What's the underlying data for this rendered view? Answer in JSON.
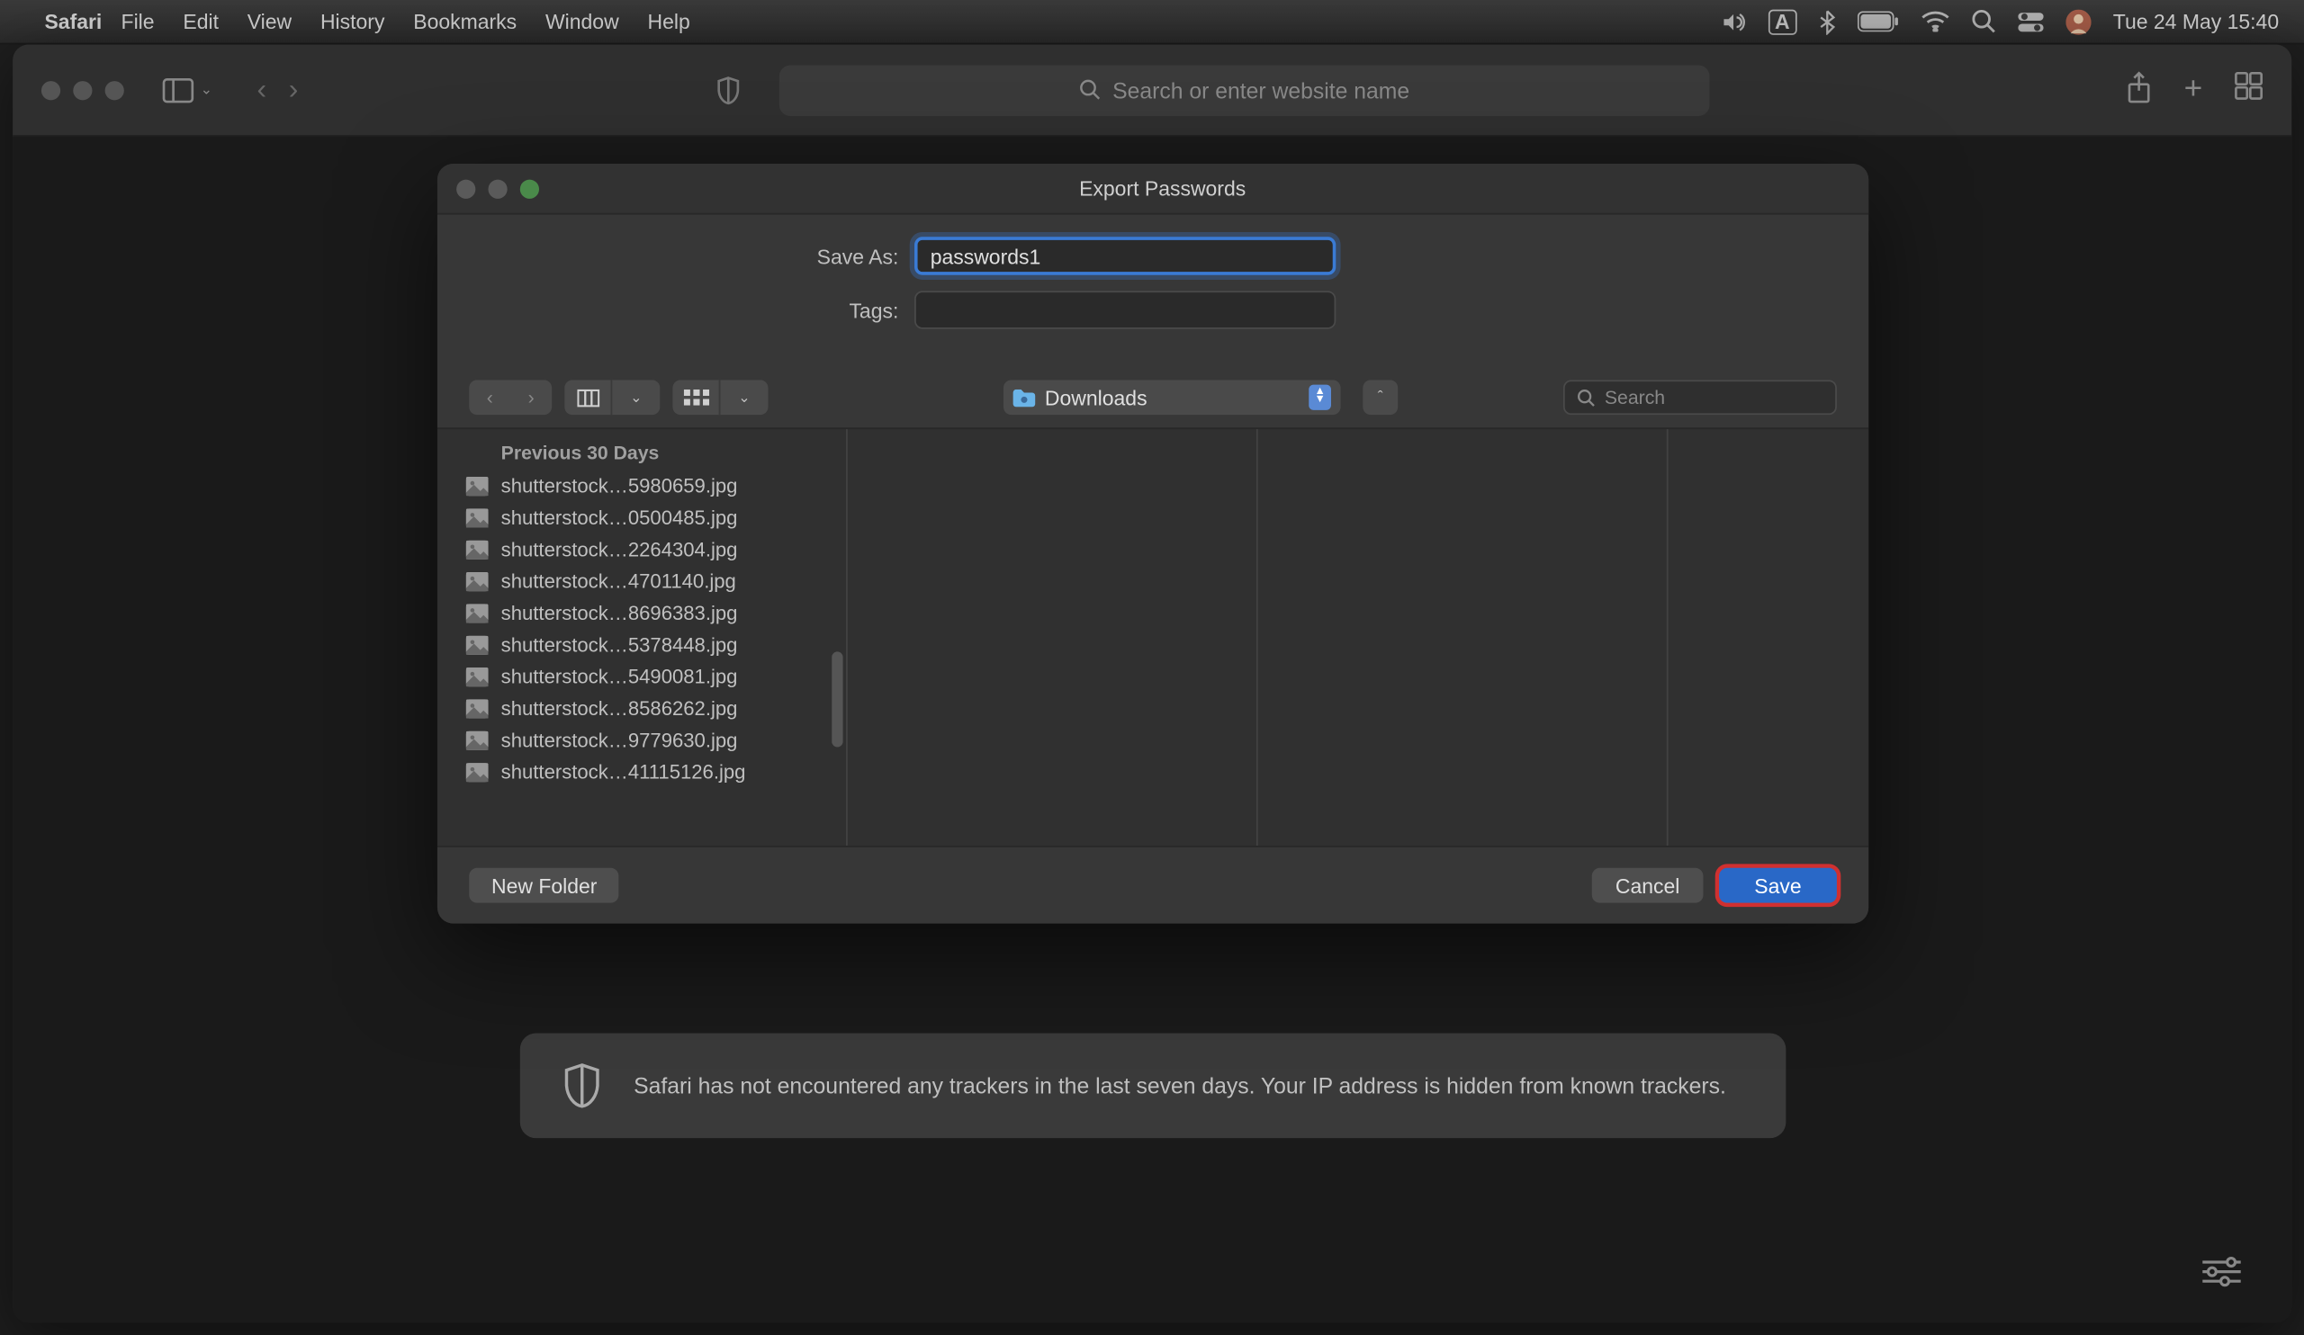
{
  "menubar": {
    "app_name": "Safari",
    "items": [
      "File",
      "Edit",
      "View",
      "History",
      "Bookmarks",
      "Window",
      "Help"
    ],
    "input_indicator": "A",
    "datetime": "Tue 24 May  15:40"
  },
  "browser": {
    "url_placeholder": "Search or enter website name"
  },
  "privacy": {
    "text": "Safari has not encountered any trackers in the last seven days. Your IP address is hidden from known trackers."
  },
  "dialog": {
    "title": "Export Passwords",
    "save_as_label": "Save As:",
    "save_as_value": "passwords1",
    "tags_label": "Tags:",
    "tags_value": "",
    "location": "Downloads",
    "search_placeholder": "Search",
    "section_header": "Previous 30 Days",
    "files": [
      "shutterstock…5980659.jpg",
      "shutterstock…0500485.jpg",
      "shutterstock…2264304.jpg",
      "shutterstock…4701140.jpg",
      "shutterstock…8696383.jpg",
      "shutterstock…5378448.jpg",
      "shutterstock…5490081.jpg",
      "shutterstock…8586262.jpg",
      "shutterstock…9779630.jpg",
      "shutterstock…41115126.jpg"
    ],
    "new_folder_label": "New Folder",
    "cancel_label": "Cancel",
    "save_label": "Save"
  }
}
